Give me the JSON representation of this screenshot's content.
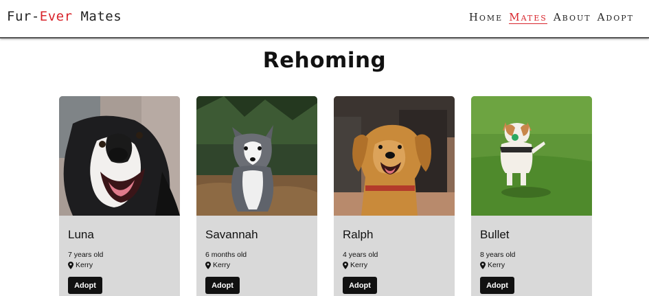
{
  "brand": {
    "part1": "Fur-",
    "accent": "Ever",
    "part2": " Mates",
    "accent_color": "#d8232a"
  },
  "nav": {
    "items": [
      {
        "label": "Home",
        "active": false
      },
      {
        "label": "Mates",
        "active": true
      },
      {
        "label": "About",
        "active": false
      },
      {
        "label": "Adopt",
        "active": false
      }
    ]
  },
  "page": {
    "title": "Rehoming"
  },
  "pets": [
    {
      "name": "Luna",
      "age": "7 years old",
      "location": "Kerry",
      "button": "Adopt",
      "photo": "border-collie-closeup"
    },
    {
      "name": "Savannah",
      "age": "6 months old",
      "location": "Kerry",
      "button": "Adopt",
      "photo": "husky-puppy-forest"
    },
    {
      "name": "Ralph",
      "age": "4 years old",
      "location": "Kerry",
      "button": "Adopt",
      "photo": "golden-retriever-cafe"
    },
    {
      "name": "Bullet",
      "age": "8 years old",
      "location": "Kerry",
      "button": "Adopt",
      "photo": "jack-russell-running-grass"
    }
  ],
  "icons": {
    "location": "map-pin-icon"
  }
}
